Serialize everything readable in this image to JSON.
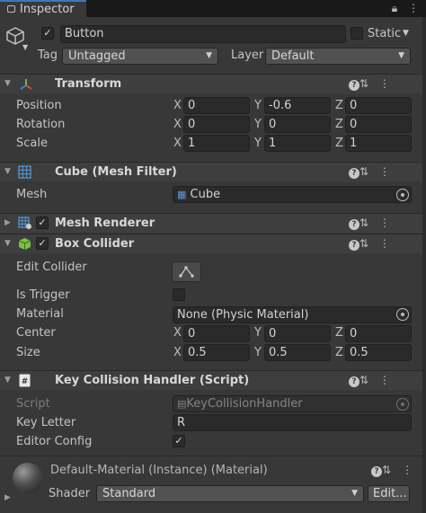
{
  "tab": {
    "title": "Inspector",
    "lock_icon": "lock-icon",
    "menu_icon": "kebab-menu-icon"
  },
  "object": {
    "name": "Button",
    "static_label": "Static",
    "tag_label": "Tag",
    "tag_value": "Untagged",
    "layer_label": "Layer",
    "layer_value": "Default"
  },
  "transform": {
    "title": "Transform",
    "position_label": "Position",
    "position": {
      "x": "0",
      "y": "-0.6",
      "z": "0"
    },
    "rotation_label": "Rotation",
    "rotation": {
      "x": "0",
      "y": "0",
      "z": "0"
    },
    "scale_label": "Scale",
    "scale": {
      "x": "1",
      "y": "1",
      "z": "1"
    }
  },
  "axes": {
    "x": "X",
    "y": "Y",
    "z": "Z"
  },
  "mesh_filter": {
    "title": "Cube (Mesh Filter)",
    "mesh_label": "Mesh",
    "mesh_value": "Cube"
  },
  "mesh_renderer": {
    "title": "Mesh Renderer"
  },
  "box_collider": {
    "title": "Box Collider",
    "edit_collider_label": "Edit Collider",
    "is_trigger_label": "Is Trigger",
    "material_label": "Material",
    "material_value": "None (Physic Material)",
    "center_label": "Center",
    "center": {
      "x": "0",
      "y": "0",
      "z": "0"
    },
    "size_label": "Size",
    "size": {
      "x": "0.5",
      "y": "0.5",
      "z": "0.5"
    }
  },
  "script_component": {
    "title": "Key Collision Handler (Script)",
    "script_label": "Script",
    "script_value": "KeyCollisionHandler",
    "key_letter_label": "Key Letter",
    "key_letter_value": "R",
    "editor_config_label": "Editor Config"
  },
  "material": {
    "title": "Default-Material (Instance) (Material)",
    "shader_label": "Shader",
    "shader_value": "Standard",
    "edit_label": "Edit..."
  },
  "colors": {
    "background": "#383838",
    "field": "#2a2a2a",
    "header": "#3e3e3e",
    "accent": "#3a79bb"
  }
}
